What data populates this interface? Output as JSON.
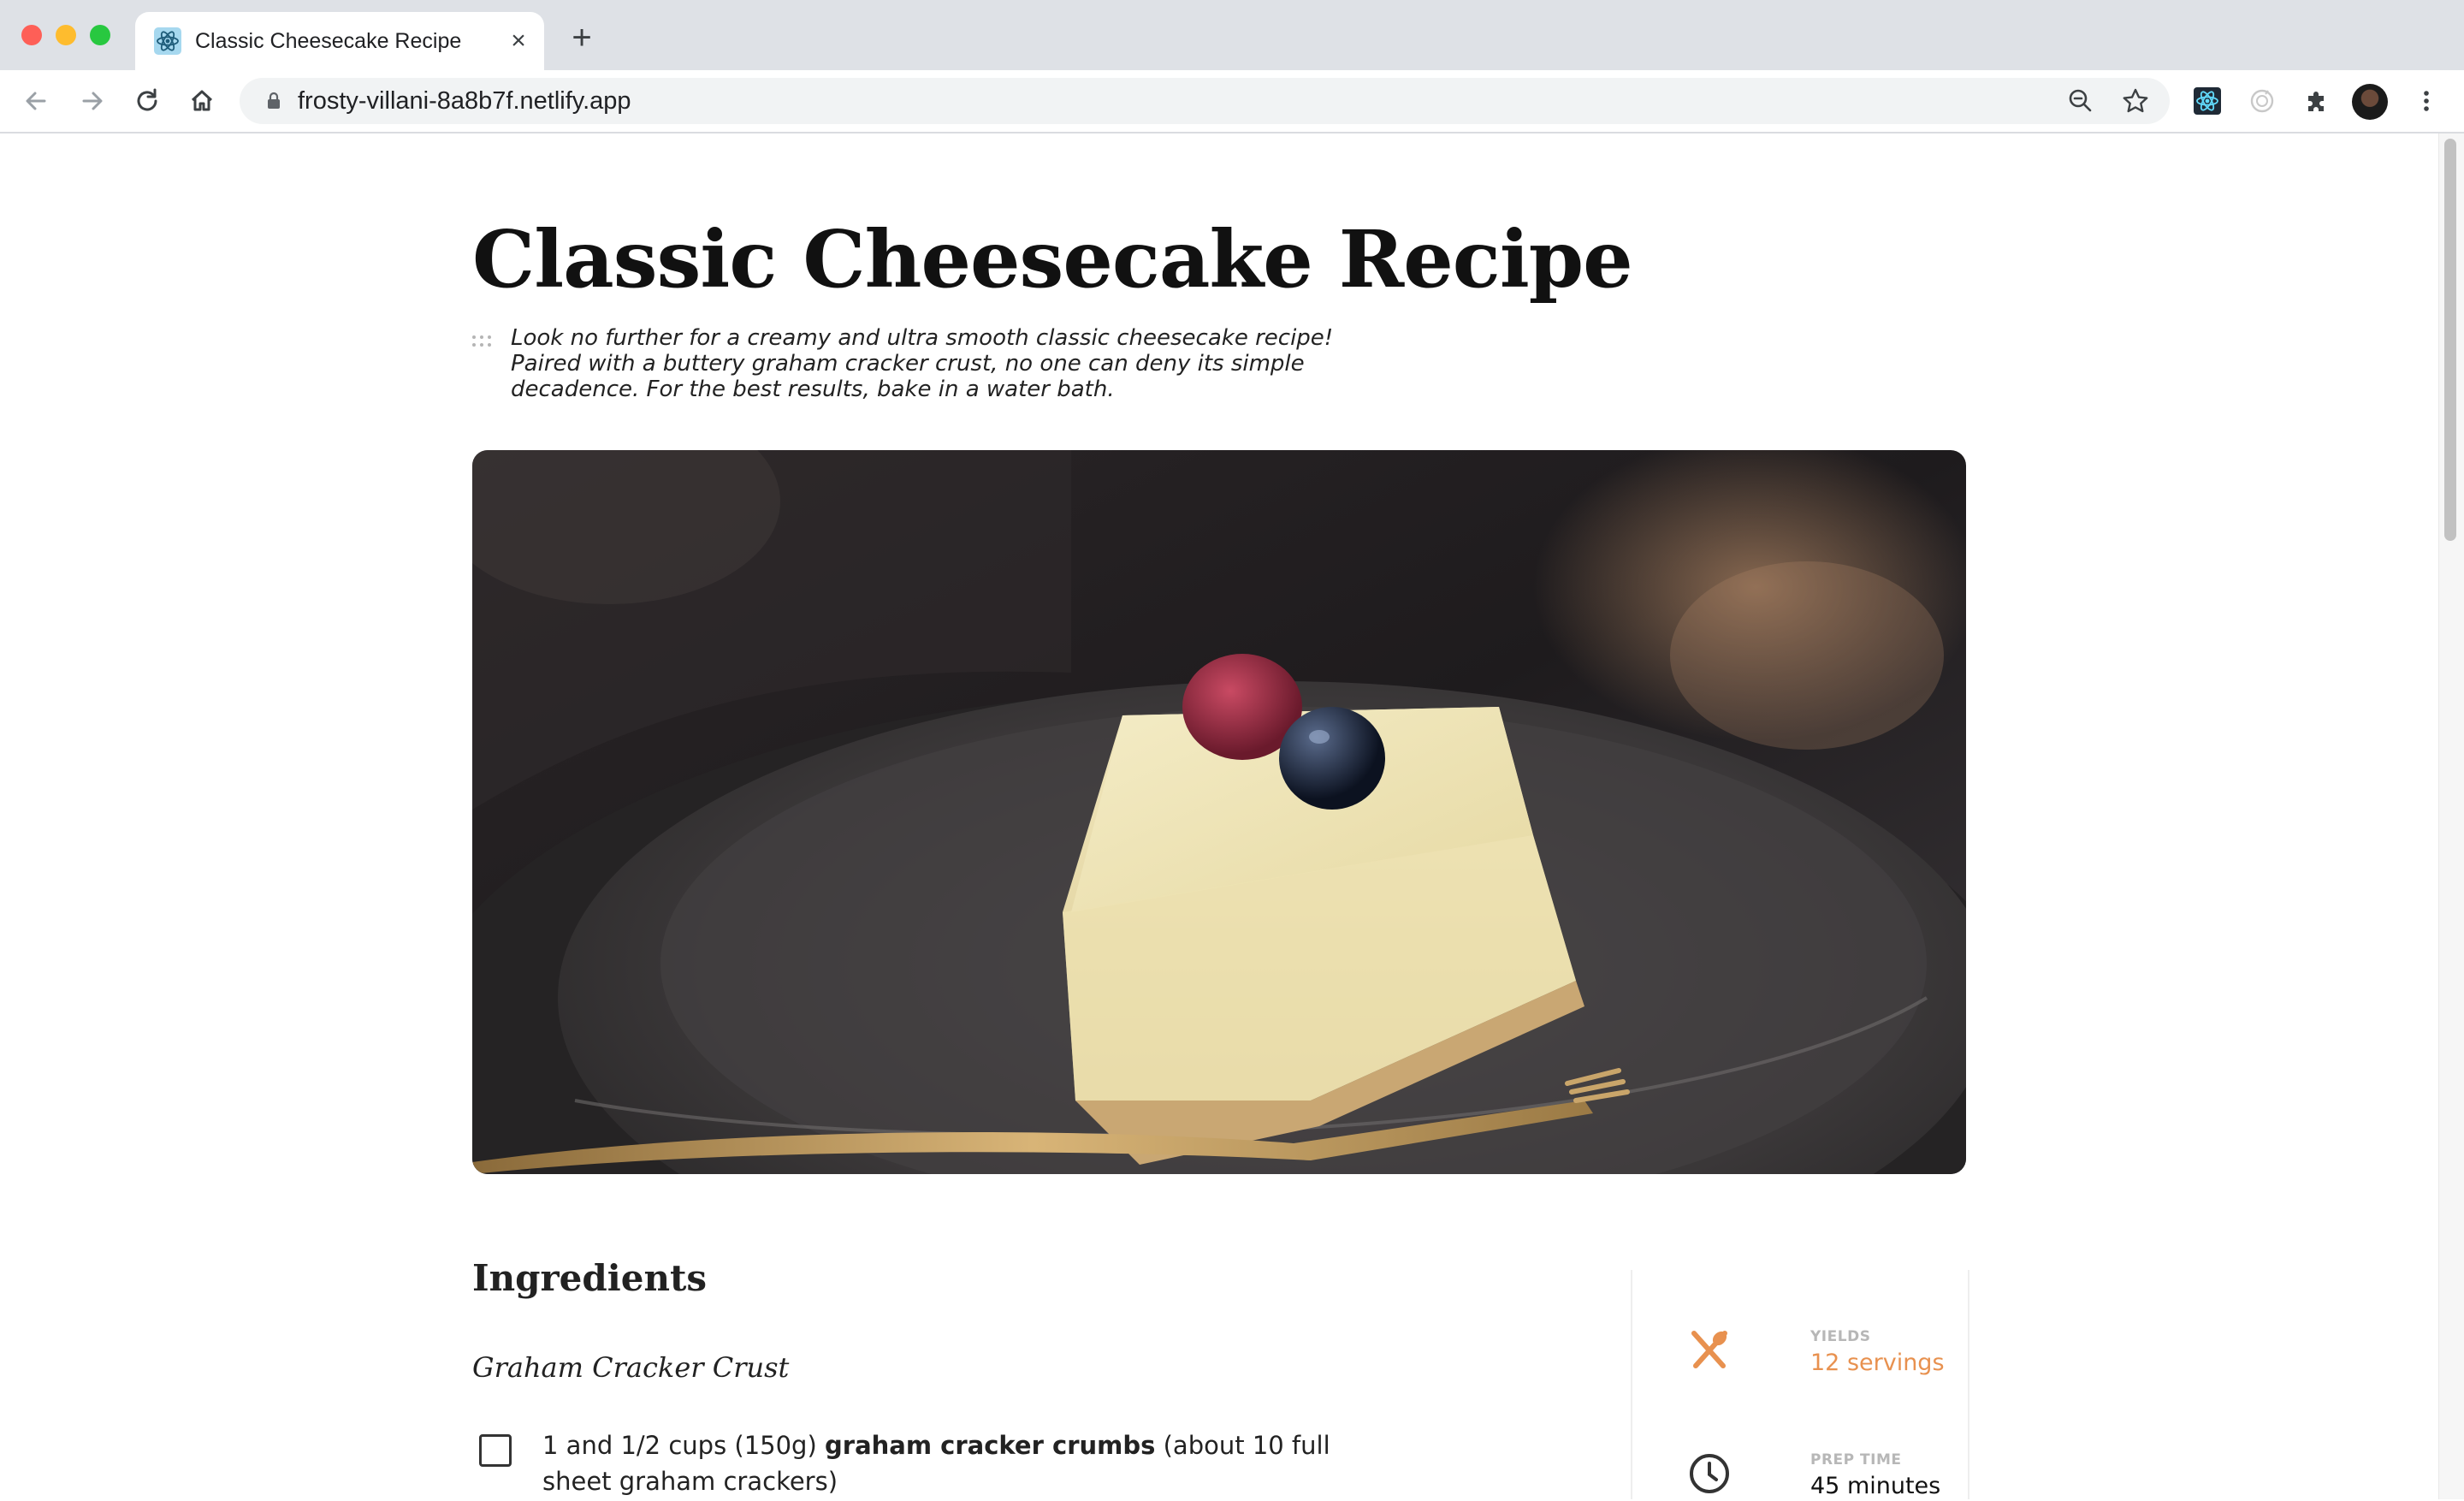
{
  "browser": {
    "tab_title": "Classic Cheesecake Recipe",
    "tab_close": "×",
    "new_tab": "+",
    "url": "frosty-villani-8a8b7f.netlify.app"
  },
  "recipe": {
    "title": "Classic Cheesecake Recipe",
    "description": "Look no further for a creamy and ultra smooth classic cheesecake recipe! Paired with a buttery graham cracker crust, no one can deny its simple decadence. For the best results, bake in a water bath."
  },
  "ingredients": {
    "heading": "Ingredients",
    "sections": [
      {
        "title": "Graham Cracker Crust",
        "items": [
          {
            "checked": false,
            "amount": "1 and 1/2 cups (150g)",
            "name": "graham cracker crumbs",
            "note": "(about 10 full sheet graham crackers)"
          }
        ]
      }
    ]
  },
  "info": {
    "yields": {
      "label": "YIELDS",
      "value": "12 servings",
      "icon": "utensils-icon"
    },
    "prep_time": {
      "label": "PREP TIME",
      "value": "45 minutes",
      "icon": "clock-icon"
    }
  },
  "colors": {
    "accent": "#e8914f",
    "text": "#111111",
    "muted_label": "#b7b7b7",
    "chrome_bg": "#dee1e6"
  }
}
